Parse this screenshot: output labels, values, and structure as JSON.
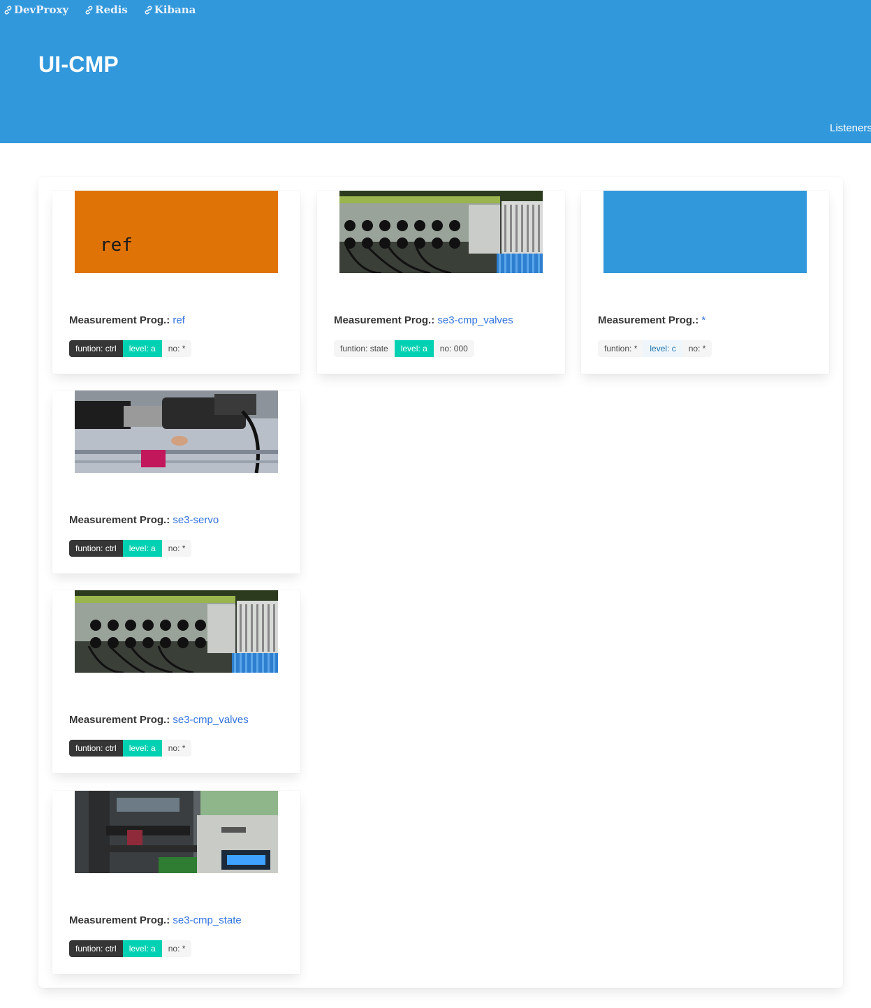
{
  "nav": {
    "links": [
      {
        "label": "DevProxy",
        "icon": "link-icon"
      },
      {
        "label": "Redis",
        "icon": "link-icon"
      },
      {
        "label": "Kibana",
        "icon": "link-icon"
      }
    ],
    "right_item": "Listeners"
  },
  "hero": {
    "title": "UI-CMP",
    "color": "#3298dc"
  },
  "label_prefix": "Measurement Prog.:",
  "cards": [
    {
      "image": {
        "kind": "text",
        "text": "ref",
        "color": "#e07305"
      },
      "prog": "ref",
      "tags": [
        {
          "text": "funtion: ctrl",
          "style": "dark"
        },
        {
          "text": "level: a",
          "style": "primary"
        },
        {
          "text": "no: *",
          "style": "light"
        }
      ]
    },
    {
      "image": {
        "kind": "photo",
        "subject": "valves"
      },
      "prog": "se3-cmp_valves",
      "tags": [
        {
          "text": "funtion: state",
          "style": "light"
        },
        {
          "text": "level: a",
          "style": "primary"
        },
        {
          "text": "no: 000",
          "style": "light"
        }
      ]
    },
    {
      "image": {
        "kind": "blank",
        "color": "#3298dc"
      },
      "prog": "*",
      "tags": [
        {
          "text": "funtion: *",
          "style": "light"
        },
        {
          "text": "level: c",
          "style": "info-light"
        },
        {
          "text": "no: *",
          "style": "light"
        }
      ]
    },
    {
      "image": {
        "kind": "photo",
        "subject": "servo"
      },
      "prog": "se3-servo",
      "tags": [
        {
          "text": "funtion: ctrl",
          "style": "dark"
        },
        {
          "text": "level: a",
          "style": "primary"
        },
        {
          "text": "no: *",
          "style": "light"
        }
      ]
    },
    {
      "image": {
        "kind": "photo",
        "subject": "valves"
      },
      "prog": "se3-cmp_valves",
      "tags": [
        {
          "text": "funtion: ctrl",
          "style": "dark"
        },
        {
          "text": "level: a",
          "style": "primary"
        },
        {
          "text": "no: *",
          "style": "light"
        }
      ]
    },
    {
      "image": {
        "kind": "photo",
        "subject": "state"
      },
      "prog": "se3-cmp_state",
      "tags": [
        {
          "text": "funtion: ctrl",
          "style": "dark"
        },
        {
          "text": "level: a",
          "style": "primary"
        },
        {
          "text": "no: *",
          "style": "light"
        }
      ]
    }
  ]
}
